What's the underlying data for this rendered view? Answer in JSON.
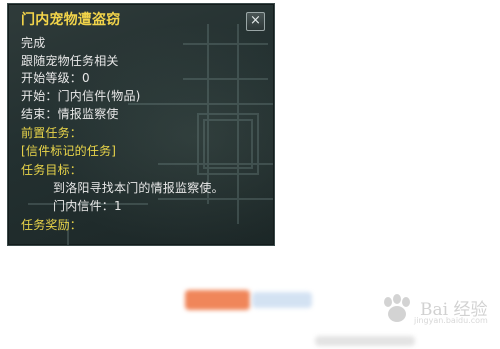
{
  "dialog": {
    "title": "门内宠物遭盗窃",
    "close_label": "×",
    "status": "完成",
    "subtitle": "跟随宠物任务相关",
    "level_line": "开始等级：0",
    "start_line": "开始：门内信件(物品)",
    "end_line": "结束：情报监察使",
    "prereq_header": "前置任务：",
    "prereq_quest": "[信件标记的任务]",
    "objective_header": "任务目标：",
    "objective_text": "到洛阳寻找本门的情报监察使。",
    "objective_item": "门内信件：1",
    "reward_header": "任务奖励："
  },
  "watermark": {
    "text": "Bai 经验",
    "url": "jingyan.baidu.com"
  },
  "colors": {
    "gold": "#e9d54a",
    "white_text": "#e8e8e8",
    "panel_bg": "#233030",
    "blur_orange": "#f08a5a",
    "blur_blue": "#a9c4e8"
  }
}
